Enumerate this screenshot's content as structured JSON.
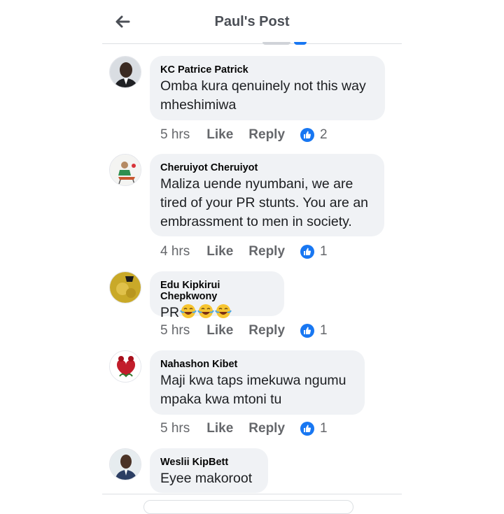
{
  "header": {
    "title": "Paul's Post"
  },
  "comments": [
    {
      "author": "KC Patrice Patrick",
      "text": "Omba kura qenuinely not this way mheshimiwa",
      "time": "5 hrs",
      "like": "Like",
      "reply": "Reply",
      "reactions": "2"
    },
    {
      "author": "Cheruiyot Cheruiyot",
      "text": "Maliza uende nyumbani, we are tired of your PR stunts. You are an embrassment to men in society.",
      "time": "4 hrs",
      "like": "Like",
      "reply": "Reply",
      "reactions": "1"
    },
    {
      "author": "Edu Kipkirui Chepkwony",
      "text": "PR",
      "time": "5 hrs",
      "like": "Like",
      "reply": "Reply",
      "reactions": "1"
    },
    {
      "author": "Nahashon Kibet",
      "text": "Maji kwa taps imekuwa ngumu mpaka kwa mtoni tu",
      "time": "5 hrs",
      "like": "Like",
      "reply": "Reply",
      "reactions": "1"
    },
    {
      "author": "Weslii KipBett",
      "text": "Eyee makoroot"
    }
  ],
  "colors": {
    "accent": "#1877f2",
    "muted": "#65676b",
    "bubble": "#f0f2f5"
  },
  "icons": [
    "back-arrow-icon",
    "like-reaction-icon",
    "laughing-emoji-icon"
  ]
}
